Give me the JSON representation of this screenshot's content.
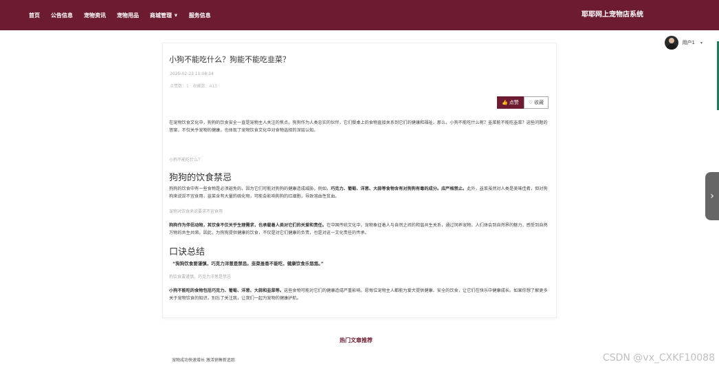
{
  "nav": {
    "items": [
      "首页",
      "公告信息",
      "宠物资讯",
      "宠物用品",
      "商城管理",
      "服务信息"
    ],
    "brand": "耶耶网上宠物店系统"
  },
  "user": {
    "name": "用户1"
  },
  "article": {
    "title": "小狗不能吃什么？狗能不能吃韭菜？",
    "date": "2025-02-23 11:08:34",
    "stats": "点赞数：1 · 收藏数：413",
    "like_label": "点赞",
    "fav_label": "收藏",
    "p1": "在宠物饮食文化中，狗狗的饮食安全一直是宠物主人关注的焦点。狗狗作为人类忠实的伙伴，它们餐桌上的食物直接关系到它们的健康和福祉。那么，小狗不能吃什么呢？韭菜能不能吃韭菜？这些问题的答案，不仅关乎宠物的健康，也体现了宠物饮食文化中对食物选择的深层认知。",
    "sub1": "小狗不能吃什么？",
    "h1": "狗狗的饮食禁忌",
    "p2_a": "狗狗的饮食中有一些食物是必须避免的，因为它们可能对狗狗的健康造成威胁。例如，",
    "p2_b": "巧克力、葡萄、洋葱、大蒜等食物含有对狗狗有毒的成分。应严格禁止。",
    "p2_c": "此外，韭菜虽然对人类是美味佳肴，但对狗狗来说却不宜食用，韭菜含有大量的硫化物，可能会影响狗狗的红细胞，导致溶血性贫血。",
    "sub2": "宠物对饮食来说要求不宜食用",
    "p3_a": "狗狗作为伴侣动物，其饮食不仅关乎生理需求，也承载着人类对它们的关爱和责任。",
    "p3_b": "在中国传统文化中，宠物象征着人与自然之间的和谐共生关系，通过饲养宠物，人们体会到自然界的魅力，感受到自然万物的共生共荣。因此，为狗狗提供健康的饮食，不仅是对它们健康的负责，也是对这一文化责任的传承。",
    "h2": "口诀总结",
    "quote": "“狗狗饮食要谨慎，巧克力洋葱是禁忌。韭菜虽香不能吃，健康饮食乐悠悠。”",
    "sub3": "狗饮食要谨慎，巧克力洋葱是禁忌",
    "p4_a": "小狗不能吃的食物包括巧克力、葡萄、洋葱、大蒜和韭菜等。",
    "p4_b": "这些食物可能对它们的健康造成严重影响。愿每位宠物主人都能为爱犬提供健康、安全的饮食，让它们在快乐中健康成长。如果你想了解更多关于宠物饮食的知识，别忘了关注我，让我们一起为宠物的健康护航。"
  },
  "hot": {
    "title": "热门文章推荐",
    "items": [
      "宠物成功快速增长 激活销售新追踪"
    ]
  },
  "watermark": "CSDN @vx_CXKF10088"
}
